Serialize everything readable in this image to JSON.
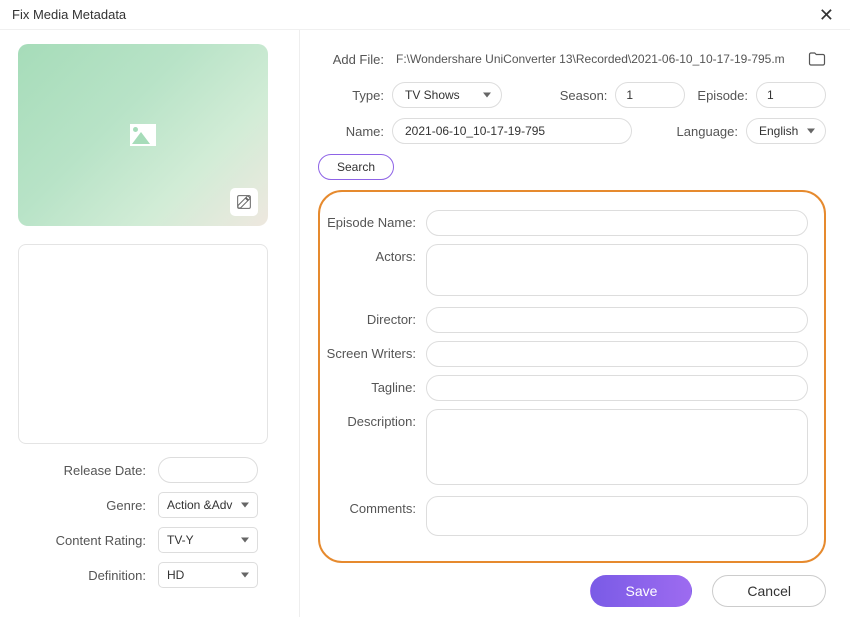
{
  "window": {
    "title": "Fix Media Metadata"
  },
  "left": {
    "releaseDateLabel": "Release Date:",
    "releaseDateValue": "",
    "genreLabel": "Genre:",
    "genreValue": "Action &Adv",
    "contentRatingLabel": "Content Rating:",
    "contentRatingValue": "TV-Y",
    "definitionLabel": "Definition:",
    "definitionValue": "HD"
  },
  "top": {
    "addFileLabel": "Add File:",
    "addFileValue": "F:\\Wondershare UniConverter 13\\Recorded\\2021-06-10_10-17-19-795.m",
    "typeLabel": "Type:",
    "typeValue": "TV Shows",
    "seasonLabel": "Season:",
    "seasonValue": "1",
    "episodeLabel": "Episode:",
    "episodeValue": "1",
    "nameLabel": "Name:",
    "nameValue": "2021-06-10_10-17-19-795",
    "languageLabel": "Language:",
    "languageValue": "English",
    "searchLabel": "Search"
  },
  "meta": {
    "episodeNameLabel": "Episode Name:",
    "episodeNameValue": "",
    "actorsLabel": "Actors:",
    "actorsValue": "",
    "directorLabel": "Director:",
    "directorValue": "",
    "screenWritersLabel": "Screen Writers:",
    "screenWritersValue": "",
    "taglineLabel": "Tagline:",
    "taglineValue": "",
    "descriptionLabel": "Description:",
    "descriptionValue": "",
    "commentsLabel": "Comments:",
    "commentsValue": ""
  },
  "footer": {
    "saveLabel": "Save",
    "cancelLabel": "Cancel"
  }
}
